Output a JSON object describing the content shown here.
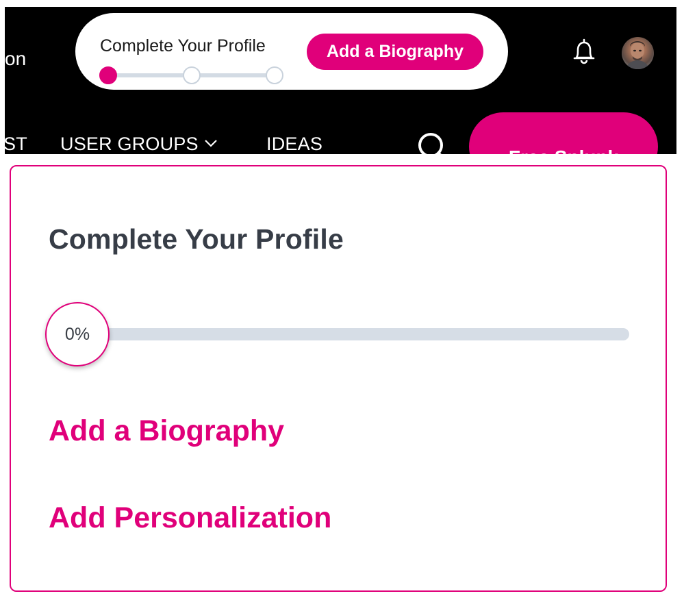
{
  "header": {
    "cut_left_text": "on",
    "profile_prompt": {
      "title": "Complete Your Profile",
      "button_label": "Add a Biography",
      "steps": [
        {
          "state": "done"
        },
        {
          "state": "pending"
        },
        {
          "state": "pending"
        }
      ]
    },
    "icons": {
      "bell": "bell-icon",
      "avatar": "avatar"
    },
    "nav": {
      "cut_item": "ST",
      "items": [
        {
          "label": "USER GROUPS",
          "has_dropdown": true
        },
        {
          "label": "IDEAS",
          "has_dropdown": false
        }
      ]
    },
    "search_icon": "search-icon",
    "free_button_label": "Free Splunk"
  },
  "card": {
    "title": "Complete Your Profile",
    "progress_label": "0%",
    "progress_fraction": 0,
    "links": [
      {
        "label": "Add a Biography"
      },
      {
        "label": "Add Personalization"
      }
    ]
  },
  "colors": {
    "accent": "#e0007a",
    "header_bg": "#000000",
    "title_text": "#373d47",
    "track": "#d6dde6"
  }
}
